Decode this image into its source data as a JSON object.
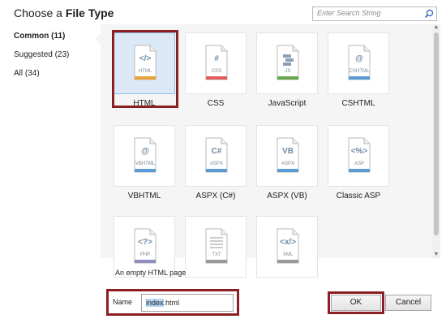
{
  "dialog": {
    "title_prefix": "Choose a ",
    "title_bold": "File Type",
    "search": {
      "placeholder": "Enter Search String"
    }
  },
  "sidebar": {
    "items": [
      {
        "label": "Common (11)",
        "selected": true
      },
      {
        "label": "Suggested (23)",
        "selected": false
      },
      {
        "label": "All (34)",
        "selected": false
      }
    ]
  },
  "tiles": [
    {
      "label": "HTML",
      "glyph": "</>",
      "tag": "HTML",
      "bar": "#e8a33b",
      "icon": "html-file-icon",
      "selected": true
    },
    {
      "label": "CSS",
      "glyph": "#",
      "tag": "CSS",
      "bar": "#e25b5b",
      "icon": "css-file-icon",
      "selected": false
    },
    {
      "label": "JavaScript",
      "glyph": "",
      "tag": "JS",
      "bar": "#6aa84f",
      "icon": "javascript-file-icon",
      "selected": false
    },
    {
      "label": "CSHTML",
      "glyph": "@",
      "tag": "CSHTML",
      "bar": "#5b9bd5",
      "icon": "cshtml-file-icon",
      "selected": false
    },
    {
      "label": "VBHTML",
      "glyph": "@",
      "tag": "VBHTML",
      "bar": "#5b9bd5",
      "icon": "vbhtml-file-icon",
      "selected": false
    },
    {
      "label": "ASPX (C#)",
      "glyph": "C#",
      "tag": "ASPX",
      "bar": "#5b9bd5",
      "icon": "aspx-cs-file-icon",
      "selected": false
    },
    {
      "label": "ASPX (VB)",
      "glyph": "VB",
      "tag": "ASPX",
      "bar": "#5b9bd5",
      "icon": "aspx-vb-file-icon",
      "selected": false
    },
    {
      "label": "Classic ASP",
      "glyph": "<%>",
      "tag": "ASP",
      "bar": "#5b9bd5",
      "icon": "classic-asp-file-icon",
      "selected": false
    },
    {
      "label": "",
      "glyph": "<?>",
      "tag": "PHP",
      "bar": "#8e8ebf",
      "icon": "php-file-icon",
      "selected": false
    },
    {
      "label": "",
      "glyph": "",
      "tag": "TXT",
      "bar": "#9a9a9a",
      "icon": "text-file-icon",
      "selected": false
    },
    {
      "label": "",
      "glyph": "<x/>",
      "tag": "XML",
      "bar": "#9a9a9a",
      "icon": "xml-file-icon",
      "selected": false
    }
  ],
  "description": "An empty HTML page",
  "footer": {
    "name_label": "Name",
    "name_value_selected": "index",
    "name_value_rest": ".html",
    "ok_label": "OK",
    "cancel_label": "Cancel"
  },
  "colors": {
    "highlight_outline": "#8b1f24",
    "selected_tile_bg": "#dbe9f6",
    "panel_bg": "#f5f5f5"
  }
}
